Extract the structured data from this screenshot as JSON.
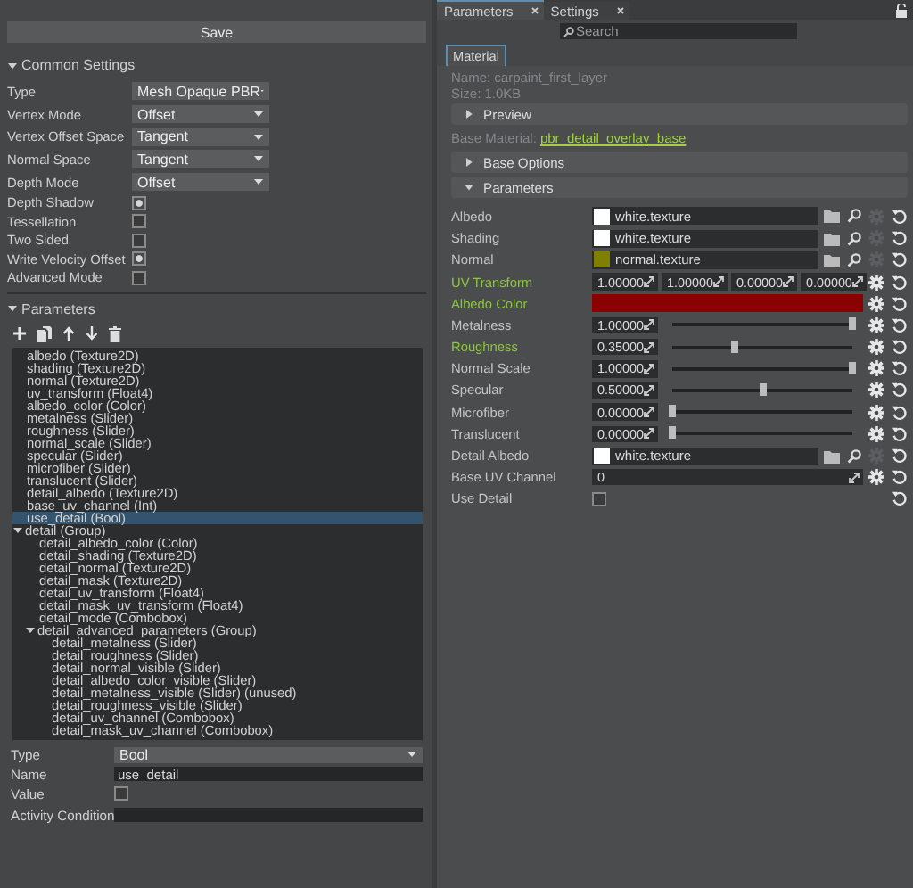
{
  "left": {
    "save_button": "Save",
    "common_settings": {
      "title": "Common Settings",
      "expanded": true,
      "dropdowns": [
        {
          "label": "Type",
          "value": "Mesh Opaque PBR"
        },
        {
          "label": "Vertex Mode",
          "value": "Offset"
        },
        {
          "label": "Vertex Offset Space",
          "value": "Tangent"
        },
        {
          "label": "Normal Space",
          "value": "Tangent"
        },
        {
          "label": "Depth Mode",
          "value": "Offset"
        }
      ],
      "checkboxes": [
        {
          "label": "Depth Shadow",
          "checked": true
        },
        {
          "label": "Tessellation",
          "checked": false
        },
        {
          "label": "Two Sided",
          "checked": false
        },
        {
          "label": "Write Velocity Offset",
          "checked": true
        },
        {
          "label": "Advanced Mode",
          "checked": false
        }
      ]
    },
    "parameters": {
      "title": "Parameters",
      "expanded": true,
      "items": [
        {
          "label": "albedo (Texture2D)",
          "selected": false
        },
        {
          "label": "shading (Texture2D)",
          "selected": false
        },
        {
          "label": "normal (Texture2D)",
          "selected": false
        },
        {
          "label": "uv_transform (Float4)",
          "selected": false
        },
        {
          "label": "albedo_color (Color)",
          "selected": false
        },
        {
          "label": "metalness (Slider)",
          "selected": false
        },
        {
          "label": "roughness (Slider)",
          "selected": false
        },
        {
          "label": "normal_scale (Slider)",
          "selected": false
        },
        {
          "label": "specular (Slider)",
          "selected": false
        },
        {
          "label": "microfiber (Slider)",
          "selected": false
        },
        {
          "label": "translucent (Slider)",
          "selected": false
        },
        {
          "label": "detail_albedo (Texture2D)",
          "selected": false
        },
        {
          "label": "base_uv_channel (Int)",
          "selected": false
        },
        {
          "label": "use_detail (Bool)",
          "selected": true
        },
        {
          "label": "detail (Group)",
          "selected": false,
          "expanded": true,
          "children": [
            {
              "label": "detail_albedo_color (Color)",
              "selected": false
            },
            {
              "label": "detail_shading (Texture2D)",
              "selected": false
            },
            {
              "label": "detail_normal (Texture2D)",
              "selected": false
            },
            {
              "label": "detail_mask (Texture2D)",
              "selected": false
            },
            {
              "label": "detail_uv_transform (Float4)",
              "selected": false
            },
            {
              "label": "detail_mask_uv_transform (Float4)",
              "selected": false
            },
            {
              "label": "detail_mode (Combobox)",
              "selected": false
            },
            {
              "label": "detail_advanced_parameters (Group)",
              "selected": false,
              "expanded": true,
              "children": [
                {
                  "label": "detail_metalness (Slider)",
                  "selected": false
                },
                {
                  "label": "detail_roughness (Slider)",
                  "selected": false
                },
                {
                  "label": "detail_normal_visible (Slider)",
                  "selected": false
                },
                {
                  "label": "detail_albedo_color_visible (Slider)",
                  "selected": false
                },
                {
                  "label": "detail_metalness_visible (Slider) (unused)",
                  "selected": false
                },
                {
                  "label": "detail_roughness_visible (Slider)",
                  "selected": false
                },
                {
                  "label": "detail_uv_channel (Combobox)",
                  "selected": false
                },
                {
                  "label": "detail_mask_uv_channel (Combobox)",
                  "selected": false
                }
              ]
            }
          ]
        }
      ]
    },
    "properties": {
      "type": {
        "label": "Type",
        "value": "Bool"
      },
      "name": {
        "label": "Name",
        "value": "use_detail"
      },
      "value": {
        "label": "Value",
        "checked": false
      },
      "activity_condition": {
        "label": "Activity Condition"
      }
    }
  },
  "right": {
    "tabs": [
      {
        "label": "Parameters",
        "selected": true
      },
      {
        "label": "Settings",
        "selected": false
      }
    ],
    "search": {
      "placeholder": "Search"
    },
    "material_tab": "Material",
    "name": "Name: carpaint_first_layer",
    "size": "Size: 1.0KB",
    "preview": {
      "title": "Preview",
      "expanded": false
    },
    "base_material": {
      "label": "Base Material:",
      "link": "pbr_detail_overlay_base"
    },
    "base_options": {
      "title": "Base Options",
      "expanded": false
    },
    "parameters": {
      "title": "Parameters",
      "expanded": true,
      "rows": [
        {
          "kind": "texture",
          "label": "Albedo",
          "modified": false,
          "color": "#ffffff",
          "value": "white.texture"
        },
        {
          "kind": "texture",
          "label": "Shading",
          "modified": false,
          "color": "#ffffff",
          "value": "white.texture"
        },
        {
          "kind": "texture",
          "label": "Normal",
          "modified": false,
          "color": "#7f7f00",
          "value": "normal.texture"
        },
        {
          "kind": "vector",
          "label": "UV Transform",
          "modified": true,
          "values": [
            "1.00000",
            "1.00000",
            "0.00000",
            "0.00000"
          ]
        },
        {
          "kind": "color",
          "label": "Albedo Color",
          "modified": true,
          "color": "#8b0000"
        },
        {
          "kind": "slider",
          "label": "Metalness",
          "modified": false,
          "value": "1.00000",
          "level": 1
        },
        {
          "kind": "slider",
          "label": "Roughness",
          "modified": true,
          "value": "0.35000",
          "level": 0.35
        },
        {
          "kind": "slider",
          "label": "Normal Scale",
          "modified": false,
          "value": "1.00000",
          "level": 1
        },
        {
          "kind": "slider",
          "label": "Specular",
          "modified": false,
          "value": "0.50000",
          "level": 0.5
        },
        {
          "kind": "slider",
          "label": "Microfiber",
          "modified": false,
          "value": "0.00000",
          "level": 0
        },
        {
          "kind": "slider",
          "label": "Translucent",
          "modified": false,
          "value": "0.00000",
          "level": 0
        },
        {
          "kind": "texture",
          "label": "Detail Albedo",
          "modified": false,
          "color": "#ffffff",
          "value": "white.texture"
        },
        {
          "kind": "int",
          "label": "Base UV Channel",
          "modified": false,
          "value": "0"
        },
        {
          "kind": "checkbox",
          "label": "Use Detail",
          "modified": false,
          "checked": false
        }
      ]
    }
  }
}
